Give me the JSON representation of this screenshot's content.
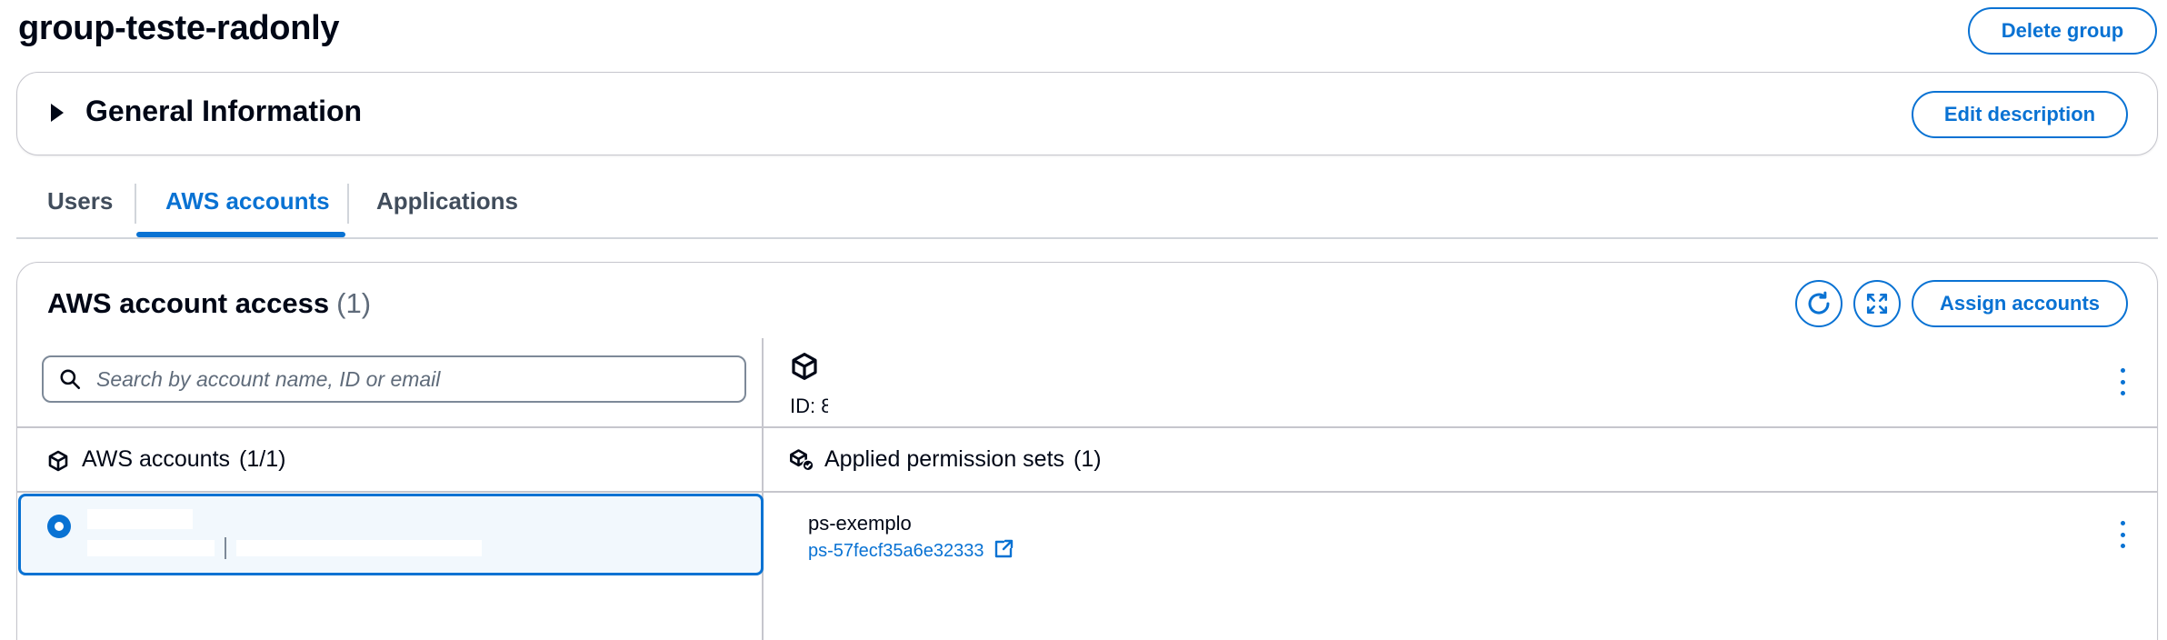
{
  "page": {
    "title": "group-teste-radonly",
    "delete_button": "Delete group"
  },
  "general_info": {
    "title": "General Information",
    "edit_button": "Edit description"
  },
  "tabs": [
    {
      "label": "Users",
      "active": false
    },
    {
      "label": "AWS accounts",
      "active": true
    },
    {
      "label": "Applications",
      "active": false
    }
  ],
  "access_panel": {
    "title": "AWS account access",
    "count": "(1)",
    "assign_button": "Assign accounts",
    "refresh_icon": "refresh-icon",
    "fullscreen_icon": "fullscreen-icon"
  },
  "search": {
    "placeholder": "Search by account name, ID or email"
  },
  "accounts_list": {
    "title": "AWS accounts",
    "count": "(1/1)",
    "selected": true
  },
  "account_detail": {
    "id_label": "ID: 8"
  },
  "permission_sets": {
    "title": "Applied permission sets",
    "count": "(1)",
    "items": [
      {
        "name": "ps-exemplo",
        "id": "ps-57fecf35a6e32333"
      }
    ]
  },
  "colors": {
    "accent": "#0972d3",
    "text": "#000716",
    "muted": "#5f6b7a",
    "border": "#c6c6cd"
  }
}
